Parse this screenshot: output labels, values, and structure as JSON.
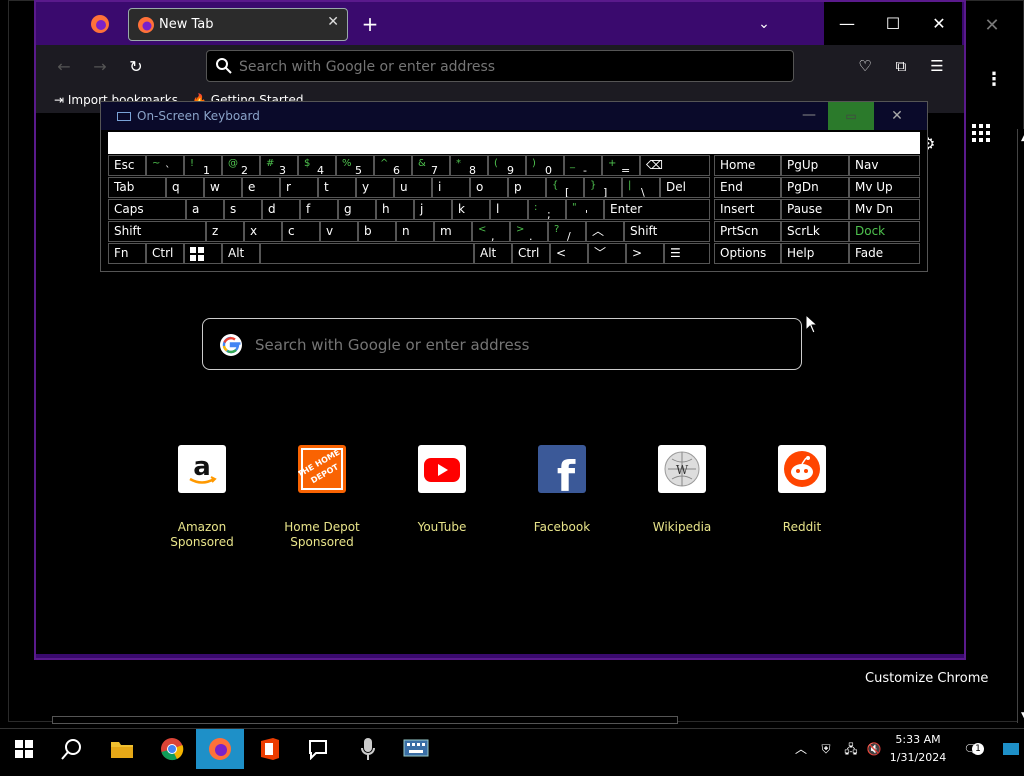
{
  "firefox": {
    "tab_title": "New Tab",
    "url_placeholder": "Search with Google or enter address",
    "bookmarks": [
      "Import bookmarks",
      "Getting Started"
    ]
  },
  "newtab": {
    "search_placeholder": "Search with Google or enter address",
    "tiles": [
      {
        "name": "Amazon",
        "sponsored": "Sponsored"
      },
      {
        "name": "Home Depot",
        "sponsored": "Sponsored"
      },
      {
        "name": "YouTube",
        "sponsored": ""
      },
      {
        "name": "Facebook",
        "sponsored": ""
      },
      {
        "name": "Wikipedia",
        "sponsored": ""
      },
      {
        "name": "Reddit",
        "sponsored": ""
      }
    ]
  },
  "background_window": {
    "customize_label": "Customize Chrome"
  },
  "osk": {
    "title": "On-Screen Keyboard",
    "keys": {
      "esc": "Esc",
      "tab": "Tab",
      "caps": "Caps",
      "shift": "Shift",
      "fn": "Fn",
      "ctrl": "Ctrl",
      "alt": "Alt",
      "del": "Del",
      "enter": "Enter",
      "home": "Home",
      "pgup": "PgUp",
      "nav": "Nav",
      "end": "End",
      "pgdn": "PgDn",
      "mvup": "Mv Up",
      "insert": "Insert",
      "pause": "Pause",
      "mvdn": "Mv Dn",
      "prtscn": "PrtScn",
      "scrlk": "ScrLk",
      "dock": "Dock",
      "options": "Options",
      "help": "Help",
      "fade": "Fade"
    },
    "row_numbers": [
      {
        "s": "~",
        "b": "`"
      },
      {
        "s": "!",
        "b": "1"
      },
      {
        "s": "@",
        "b": "2"
      },
      {
        "s": "#",
        "b": "3"
      },
      {
        "s": "$",
        "b": "4"
      },
      {
        "s": "%",
        "b": "5"
      },
      {
        "s": "^",
        "b": "6"
      },
      {
        "s": "&",
        "b": "7"
      },
      {
        "s": "*",
        "b": "8"
      },
      {
        "s": "(",
        "b": "9"
      },
      {
        "s": ")",
        "b": "0"
      },
      {
        "s": "_",
        "b": "-"
      },
      {
        "s": "+",
        "b": "="
      }
    ],
    "row_q": [
      "q",
      "w",
      "e",
      "r",
      "t",
      "y",
      "u",
      "i",
      "o",
      "p"
    ],
    "row_q_sym": [
      {
        "s": "{",
        "b": "["
      },
      {
        "s": "}",
        "b": "]"
      },
      {
        "s": "|",
        "b": "\\"
      }
    ],
    "row_a": [
      "a",
      "s",
      "d",
      "f",
      "g",
      "h",
      "j",
      "k",
      "l"
    ],
    "row_a_sym": [
      {
        "s": ":",
        "b": ";"
      },
      {
        "s": "\"",
        "b": "'"
      }
    ],
    "row_z": [
      "z",
      "x",
      "c",
      "v",
      "b",
      "n",
      "m"
    ],
    "row_z_sym": [
      {
        "s": "<",
        "b": ","
      },
      {
        "s": ">",
        "b": "."
      },
      {
        "s": "?",
        "b": "/"
      }
    ]
  },
  "taskbar": {
    "time": "5:33 AM",
    "date": "1/31/2024",
    "notification_count": "1"
  }
}
